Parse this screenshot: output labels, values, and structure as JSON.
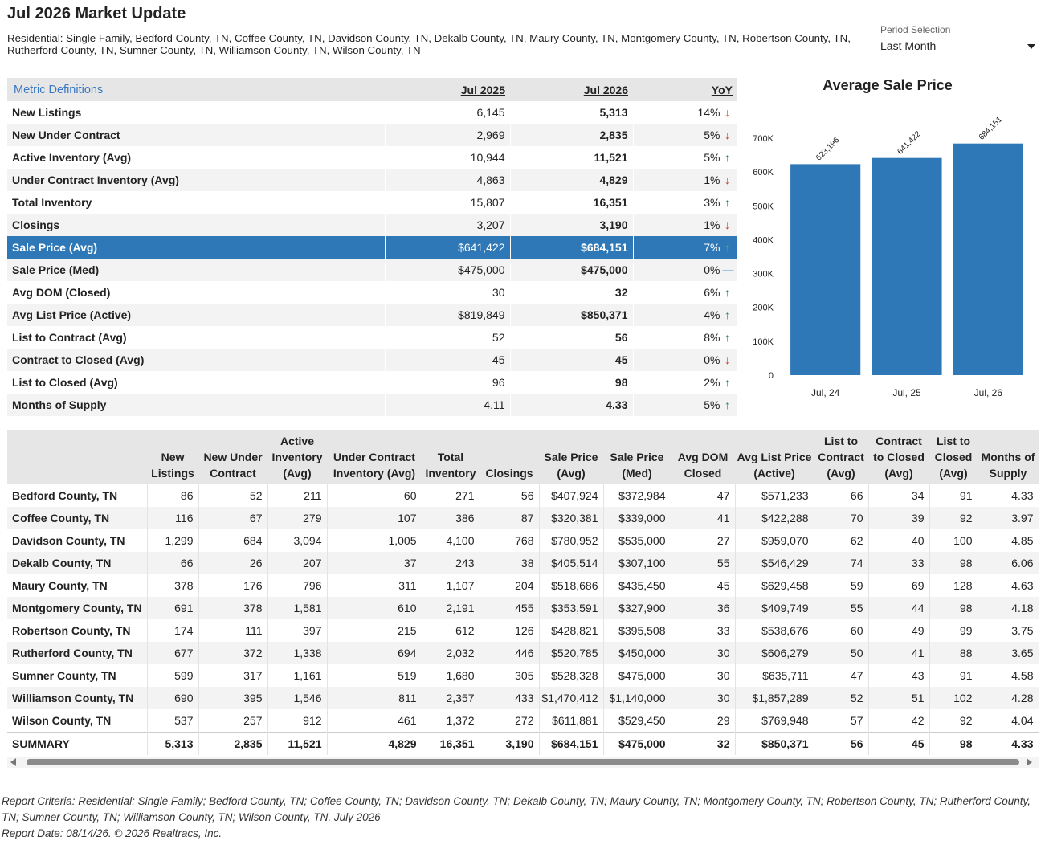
{
  "header": {
    "title": "Jul 2026 Market Update",
    "subtitle": "Residential: Single Family, Bedford County, TN, Coffee County, TN, Davidson County, TN, Dekalb County, TN, Maury County, TN, Montgomery County, TN, Robertson County, TN, Rutherford County, TN, Sumner County, TN, Williamson County, TN, Wilson County, TN"
  },
  "period": {
    "label": "Period Selection",
    "value": "Last Month"
  },
  "metrics": {
    "defs_link": "Metric Definitions",
    "col1": "Jul 2025",
    "col2": "Jul 2026",
    "col3": "YoY",
    "colors": {
      "up": "#1e8a4c",
      "down": "#c0392b",
      "highlight": "#2f78b7"
    },
    "rows": [
      {
        "name": "New Listings",
        "v1": "6,145",
        "v2": "5,313",
        "yoy": "14%",
        "dir": "down"
      },
      {
        "name": "New Under Contract",
        "v1": "2,969",
        "v2": "2,835",
        "yoy": "5%",
        "dir": "down"
      },
      {
        "name": "Active Inventory (Avg)",
        "v1": "10,944",
        "v2": "11,521",
        "yoy": "5%",
        "dir": "up"
      },
      {
        "name": "Under Contract Inventory (Avg)",
        "v1": "4,863",
        "v2": "4,829",
        "yoy": "1%",
        "dir": "down"
      },
      {
        "name": "Total Inventory",
        "v1": "15,807",
        "v2": "16,351",
        "yoy": "3%",
        "dir": "up"
      },
      {
        "name": "Closings",
        "v1": "3,207",
        "v2": "3,190",
        "yoy": "1%",
        "dir": "down"
      },
      {
        "name": "Sale Price (Avg)",
        "v1": "$641,422",
        "v2": "$684,151",
        "yoy": "7%",
        "dir": "up",
        "selected": true
      },
      {
        "name": "Sale Price (Med)",
        "v1": "$475,000",
        "v2": "$475,000",
        "yoy": "0%",
        "dir": "flat"
      },
      {
        "name": "Avg DOM (Closed)",
        "v1": "30",
        "v2": "32",
        "yoy": "6%",
        "dir": "up"
      },
      {
        "name": "Avg List Price (Active)",
        "v1": "$819,849",
        "v2": "$850,371",
        "yoy": "4%",
        "dir": "up"
      },
      {
        "name": "List to Contract (Avg)",
        "v1": "52",
        "v2": "56",
        "yoy": "8%",
        "dir": "up"
      },
      {
        "name": "Contract to Closed (Avg)",
        "v1": "45",
        "v2": "45",
        "yoy": "0%",
        "dir": "down"
      },
      {
        "name": "List to Closed (Avg)",
        "v1": "96",
        "v2": "98",
        "yoy": "2%",
        "dir": "up"
      },
      {
        "name": "Months of Supply",
        "v1": "4.11",
        "v2": "4.33",
        "yoy": "5%",
        "dir": "up"
      }
    ]
  },
  "chart_data": {
    "type": "bar",
    "title": "Average Sale Price",
    "categories": [
      "Jul, 24",
      "Jul, 25",
      "Jul, 26"
    ],
    "values": [
      623196,
      641422,
      684151
    ],
    "data_labels": [
      "623,196",
      "641,422",
      "684,151"
    ],
    "yticks": [
      "0",
      "100K",
      "200K",
      "300K",
      "400K",
      "500K",
      "600K",
      "700K"
    ],
    "ylim": [
      0,
      700000
    ],
    "grid": false,
    "bar_color": "#2f78b7"
  },
  "counties": {
    "headers": [
      "",
      "New Listings",
      "New Under Contract",
      "Active Inventory (Avg)",
      "Under Contract Inventory (Avg)",
      "Total Inventory",
      "Closings",
      "Sale Price (Avg)",
      "Sale Price (Med)",
      "Avg DOM Closed",
      "Avg List Price (Active)",
      "List to Contract (Avg)",
      "Contract to Closed (Avg)",
      "List to Closed (Avg)",
      "Months of Supply"
    ],
    "rows": [
      [
        "Bedford County, TN",
        "86",
        "52",
        "211",
        "60",
        "271",
        "56",
        "$407,924",
        "$372,984",
        "47",
        "$571,233",
        "66",
        "34",
        "91",
        "4.33"
      ],
      [
        "Coffee County, TN",
        "116",
        "67",
        "279",
        "107",
        "386",
        "87",
        "$320,381",
        "$339,000",
        "41",
        "$422,288",
        "70",
        "39",
        "92",
        "3.97"
      ],
      [
        "Davidson County, TN",
        "1,299",
        "684",
        "3,094",
        "1,005",
        "4,100",
        "768",
        "$780,952",
        "$535,000",
        "27",
        "$959,070",
        "62",
        "40",
        "100",
        "4.85"
      ],
      [
        "Dekalb County, TN",
        "66",
        "26",
        "207",
        "37",
        "243",
        "38",
        "$405,514",
        "$307,100",
        "55",
        "$546,429",
        "74",
        "33",
        "98",
        "6.06"
      ],
      [
        "Maury County, TN",
        "378",
        "176",
        "796",
        "311",
        "1,107",
        "204",
        "$518,686",
        "$435,450",
        "45",
        "$629,458",
        "59",
        "69",
        "128",
        "4.63"
      ],
      [
        "Montgomery County, TN",
        "691",
        "378",
        "1,581",
        "610",
        "2,191",
        "455",
        "$353,591",
        "$327,900",
        "36",
        "$409,749",
        "55",
        "44",
        "98",
        "4.18"
      ],
      [
        "Robertson County, TN",
        "174",
        "111",
        "397",
        "215",
        "612",
        "126",
        "$428,821",
        "$395,508",
        "33",
        "$538,676",
        "60",
        "49",
        "99",
        "3.75"
      ],
      [
        "Rutherford County, TN",
        "677",
        "372",
        "1,338",
        "694",
        "2,032",
        "446",
        "$520,785",
        "$450,000",
        "30",
        "$606,279",
        "50",
        "41",
        "88",
        "3.65"
      ],
      [
        "Sumner County, TN",
        "599",
        "317",
        "1,161",
        "519",
        "1,680",
        "305",
        "$528,328",
        "$475,000",
        "30",
        "$635,711",
        "47",
        "43",
        "91",
        "4.58"
      ],
      [
        "Williamson County, TN",
        "690",
        "395",
        "1,546",
        "811",
        "2,357",
        "433",
        "$1,470,412",
        "$1,140,000",
        "30",
        "$1,857,289",
        "52",
        "51",
        "102",
        "4.28"
      ],
      [
        "Wilson County, TN",
        "537",
        "257",
        "912",
        "461",
        "1,372",
        "272",
        "$611,881",
        "$529,450",
        "29",
        "$769,948",
        "57",
        "42",
        "92",
        "4.04"
      ]
    ],
    "summary": [
      "SUMMARY",
      "5,313",
      "2,835",
      "11,521",
      "4,829",
      "16,351",
      "3,190",
      "$684,151",
      "$475,000",
      "32",
      "$850,371",
      "56",
      "45",
      "98",
      "4.33"
    ]
  },
  "footer": {
    "criteria": "Report Criteria: Residential: Single Family; Bedford County, TN; Coffee County, TN; Davidson County, TN; Dekalb County, TN; Maury County, TN; Montgomery County, TN; Robertson County, TN; Rutherford County, TN; Sumner County, TN; Williamson County, TN; Wilson County, TN. July 2026",
    "date": "Report Date: 08/14/26. © 2026 Realtracs, Inc."
  }
}
